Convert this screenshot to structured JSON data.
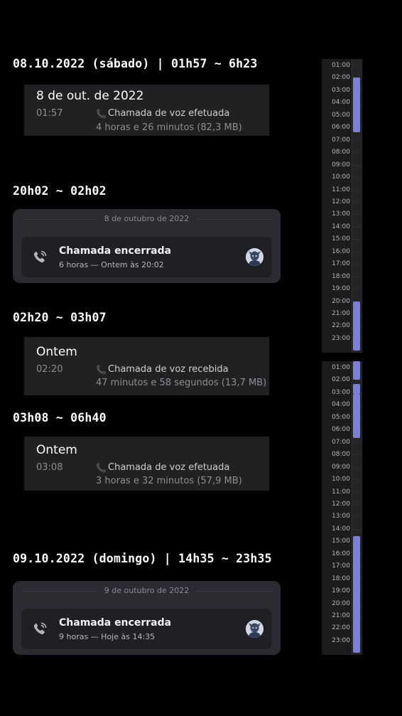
{
  "headings": {
    "h1": "08.10.2022 (sábado) | 01h57 ~ 6h23",
    "h2": "20h02 ~ 02h02",
    "h3": "02h20 ~ 03h07",
    "h4": "03h08 ~ 06h40",
    "h5": "09.10.2022 (domingo) | 14h35 ~ 23h35"
  },
  "telegram_cards": [
    {
      "head": "8 de out. de 2022",
      "time": "01:57",
      "call_label": "Chamada de voz efetuada",
      "call_meta": "4 horas e 26 minutos (82,3 MB)"
    },
    {
      "head": "Ontem",
      "time": "02:20",
      "call_label": "Chamada de voz recebida",
      "call_meta": "47 minutos e 58 segundos (13,7 MB)"
    },
    {
      "head": "Ontem",
      "time": "03:08",
      "call_label": "Chamada de voz efetuada",
      "call_meta": "3 horas e 32 minutos (57,9 MB)"
    }
  ],
  "discord_cards": [
    {
      "date": "8 de outubro de 2022",
      "title": "Chamada encerrada",
      "sub": "6 horas — Ontem às 20:02"
    },
    {
      "date": "9 de outubro de 2022",
      "title": "Chamada encerrada",
      "sub": "9 horas — Hoje às 14:35"
    }
  ],
  "timelines": [
    {
      "hours": [
        "01:00",
        "02:00",
        "03:00",
        "04:00",
        "05:00",
        "06:00",
        "07:00",
        "08:00",
        "09:00",
        "10:00",
        "11:00",
        "12:00",
        "13:00",
        "14:00",
        "15:00",
        "16:00",
        "17:00",
        "18:00",
        "19:00",
        "20:00",
        "21:00",
        "22:00",
        "23:00"
      ],
      "bars": [
        {
          "start_hour": 2.0,
          "end_hour": 6.4
        },
        {
          "start_hour": 20.0,
          "end_hour": 24.0
        }
      ]
    },
    {
      "hours": [
        "01:00",
        "02:00",
        "03:00",
        "04:00",
        "05:00",
        "06:00",
        "07:00",
        "08:00",
        "09:00",
        "10:00",
        "11:00",
        "12:00",
        "13:00",
        "14:00",
        "15:00",
        "16:00",
        "17:00",
        "18:00",
        "19:00",
        "20:00",
        "21:00",
        "22:00",
        "23:00"
      ],
      "bars": [
        {
          "start_hour": 0.5,
          "end_hour": 2.0
        },
        {
          "start_hour": 2.3,
          "end_hour": 3.1
        },
        {
          "start_hour": 3.1,
          "end_hour": 6.7
        },
        {
          "start_hour": 14.6,
          "end_hour": 24.0
        }
      ]
    }
  ],
  "colors": {
    "accent": "#7c7fd6",
    "bg": "#000000"
  },
  "icons": {
    "telegram_call": "phone-icon",
    "discord_call": "phone-call-end-icon",
    "avatar": "user-avatar"
  }
}
